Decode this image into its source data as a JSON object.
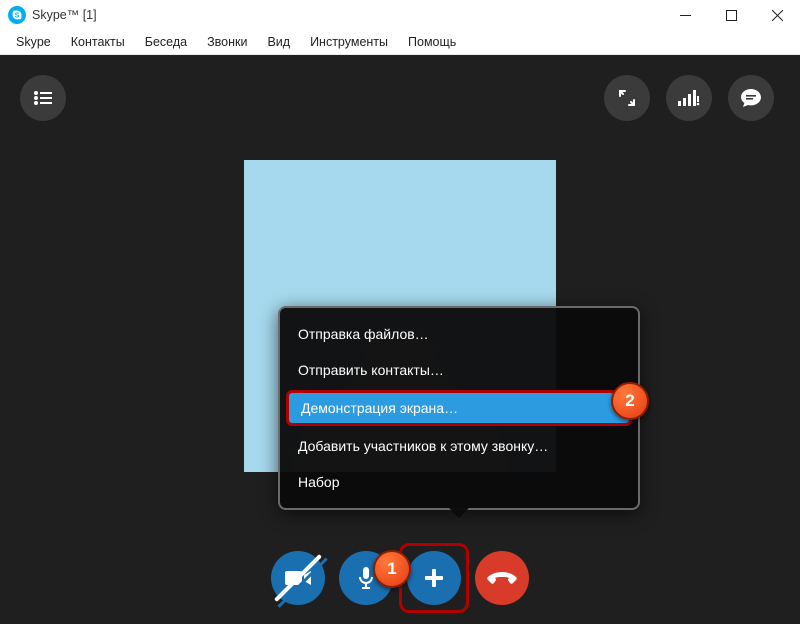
{
  "window": {
    "title": "Skype™ [1]"
  },
  "menu": {
    "items": [
      {
        "label": "Skype"
      },
      {
        "label": "Контакты"
      },
      {
        "label": "Беседа"
      },
      {
        "label": "Звонки"
      },
      {
        "label": "Вид"
      },
      {
        "label": "Инструменты"
      },
      {
        "label": "Помощь"
      }
    ]
  },
  "popup": {
    "items": [
      {
        "label": "Отправка файлов…",
        "highlight": false
      },
      {
        "label": "Отправить контакты…",
        "highlight": false
      },
      {
        "label": "Демонстрация экрана…",
        "highlight": true
      },
      {
        "label": "Добавить участников к этому звонку…",
        "highlight": false
      },
      {
        "label": "Набор",
        "highlight": false
      }
    ]
  },
  "annotations": {
    "badge1": "1",
    "badge2": "2"
  },
  "colors": {
    "call_bg": "#1f1f1f",
    "avatar_bg": "#a6d9ed",
    "btn_blue": "#1a6fb0",
    "btn_red": "#d83b2a",
    "highlight": "#2d9be0",
    "outline": "#b00000"
  }
}
